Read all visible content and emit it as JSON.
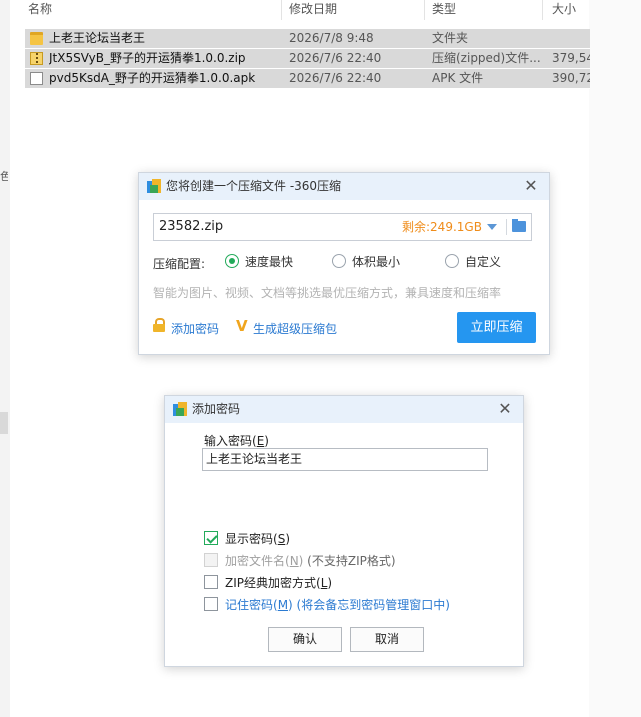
{
  "explorer": {
    "headers": {
      "name": "名称",
      "date": "修改日期",
      "type": "类型",
      "size": "大小"
    },
    "rows": [
      {
        "name": "上老王论坛当老王",
        "date": "2026/7/8 9:48",
        "type": "文件夹",
        "size": "",
        "icon": "folder-icon"
      },
      {
        "name": "JtX5SVyB_野子的开运猜拳1.0.0.zip",
        "date": "2026/7/6 22:40",
        "type": "压缩(zipped)文件...",
        "size": "379,54",
        "icon": "zip-file-icon"
      },
      {
        "name": "pvd5KsdA_野子的开运猜拳1.0.0.apk",
        "date": "2026/7/6 22:40",
        "type": "APK 文件",
        "size": "390,72",
        "icon": "apk-file-icon"
      }
    ],
    "left_edge_char": "色"
  },
  "compress_dialog": {
    "title": "您将创建一个压缩文件 -360压缩",
    "filename": "23582.zip",
    "free_space": "剩余:249.1GB",
    "config_label": "压缩配置:",
    "options": [
      "速度最快",
      "体积最小",
      "自定义"
    ],
    "selected_option": "速度最快",
    "hint": "智能为图片、视频、文档等挑选最优压缩方式，兼具速度和压缩率",
    "add_password": "添加密码",
    "super_package": "生成超级压缩包",
    "compress_now": "立即压缩",
    "colors": {
      "accent": "#2596f0",
      "radio": "#22aa5a",
      "free_space": "#ef8c1a"
    }
  },
  "password_dialog": {
    "title": "添加密码",
    "input_label": "输入密码(",
    "input_label_key": "E",
    "input_label_end": ")",
    "password_value": "上老王论坛当老王",
    "show_password": {
      "text": "显示密码(",
      "key": "S",
      "end": ")",
      "checked": true
    },
    "encrypt_names": {
      "text": "加密文件名(",
      "key": "N",
      "end": ")",
      "note": " (不支持ZIP格式)",
      "disabled": true
    },
    "zip_classic": {
      "text": "ZIP经典加密方式(",
      "key": "L",
      "end": ")"
    },
    "remember": {
      "text": "记住密码(",
      "key": "M",
      "end": ")",
      "note": " (将会备忘到密码管理窗口中)"
    },
    "ok": "确认",
    "cancel": "取消"
  }
}
